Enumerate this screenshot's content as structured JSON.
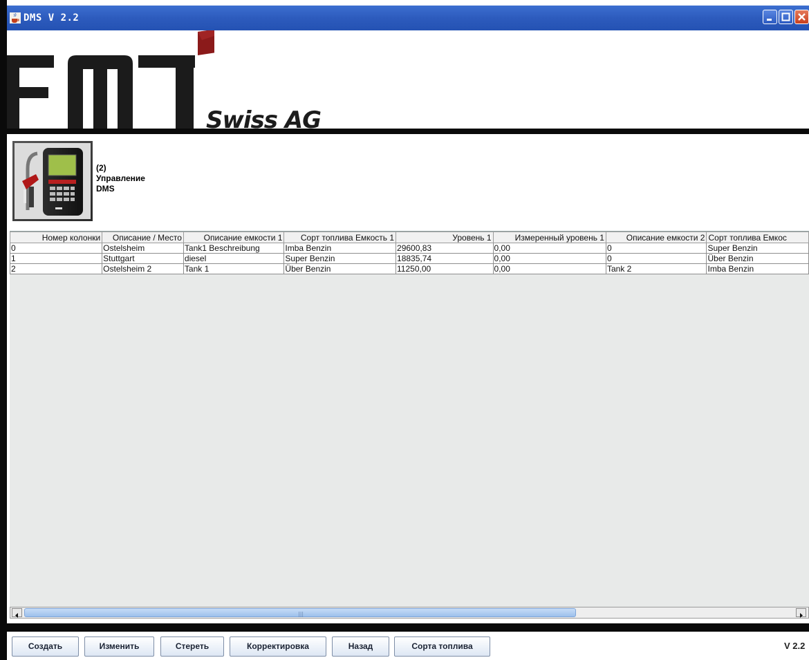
{
  "window": {
    "title": "DMS V 2.2"
  },
  "logo": {
    "text": "Swiss AG"
  },
  "device": {
    "line1": "(2)",
    "line2": "Управление",
    "line3": "DMS"
  },
  "table": {
    "columns": [
      "Номер колонки",
      "Описание / Место",
      "Описание емкости 1",
      "Сорт топлива Емкость 1",
      "Уровень 1",
      "Измеренный уровень 1",
      "Описание емкости 2",
      "Сорт топлива Емкос"
    ],
    "rows": [
      [
        "0",
        "Ostelsheim",
        "Tank1 Beschreibung",
        "Imba Benzin",
        "29600,83",
        "0,00",
        "0",
        "Super Benzin"
      ],
      [
        "1",
        "Stuttgart",
        "diesel",
        "Super Benzin",
        "18835,74",
        "0,00",
        "0",
        "Über Benzin"
      ],
      [
        "2",
        "Ostelsheim 2",
        "Tank 1",
        "Über Benzin",
        "11250,00",
        "0,00",
        "Tank 2",
        "Imba Benzin"
      ]
    ]
  },
  "buttons": {
    "create": "Создать",
    "edit": "Изменить",
    "delete": "Стереть",
    "correction": "Корректировка",
    "back": "Назад",
    "fuel_types": "Сорта топлива"
  },
  "version": "V 2.2",
  "colors": {
    "titlebar": "#2d5bbd",
    "logo_accent": "#8b1a1a",
    "selection_thumb": "#9dc0ec"
  }
}
